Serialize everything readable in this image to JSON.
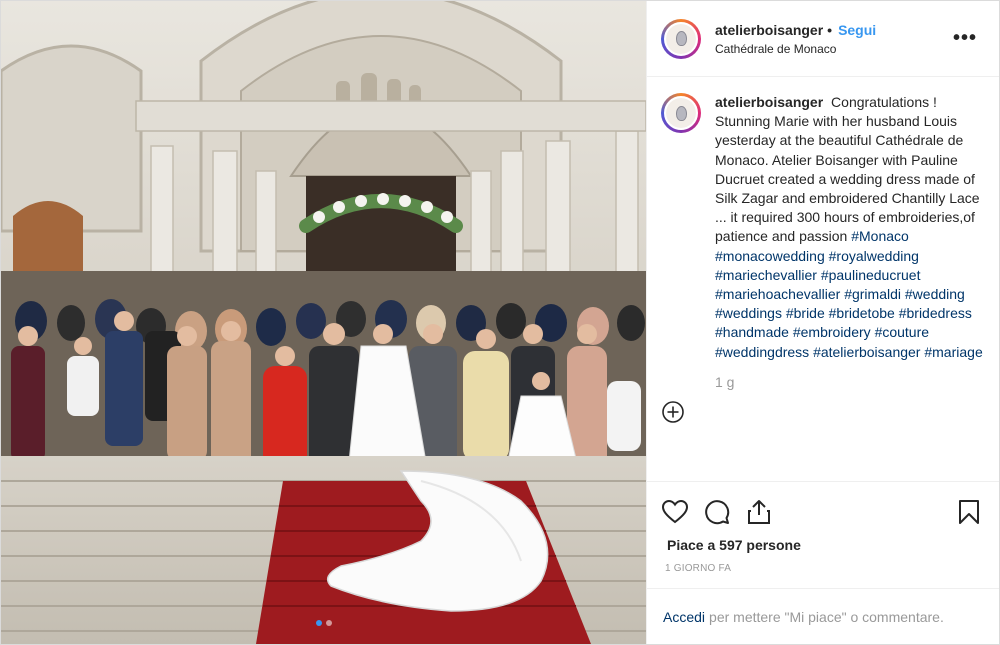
{
  "post": {
    "username": "atelierboisanger",
    "bullet": "•",
    "follow_label": "Segui",
    "location": "Cathédrale de Monaco",
    "more_label": "•••",
    "caption_text": "Congratulations ! Stunning Marie with her husband Louis yesterday at the beautiful Cathédrale de Monaco. Atelier Boisanger with Pauline Ducruet created a wedding dress made of Silk Zagar and embroidered Chantilly Lace ... it required 300 hours of embroideries,of patience and passion",
    "hashtags": [
      "#Monaco",
      "#monacowedding",
      "#royalwedding",
      "#mariechevallier",
      "#paulineducruet",
      "#mariehoachevallier",
      "#grimaldi",
      "#wedding",
      "#weddings",
      "#bride",
      "#bridetobe",
      "#bridedress",
      "#handmade",
      "#embroidery",
      "#couture",
      "#weddingdress",
      "#atelierboisanger",
      "#mariage"
    ],
    "comment_age": "1 g",
    "likes_text": "Piace a 597 persone",
    "posted_time": "1 giorno fa",
    "login_link": "Accedi",
    "login_text": "per mettere \"Mi piace\" o commentare.",
    "carousel": {
      "count": 2,
      "active": 1
    }
  },
  "icons": {
    "add": "add-comment-icon",
    "like": "heart-icon",
    "comment": "comment-icon",
    "share": "share-icon",
    "save": "bookmark-icon",
    "more": "more-icon"
  },
  "colors": {
    "link_blue": "#3897f0",
    "hashtag": "#003569",
    "muted": "#999999",
    "carpet": "#9e1b1f"
  }
}
